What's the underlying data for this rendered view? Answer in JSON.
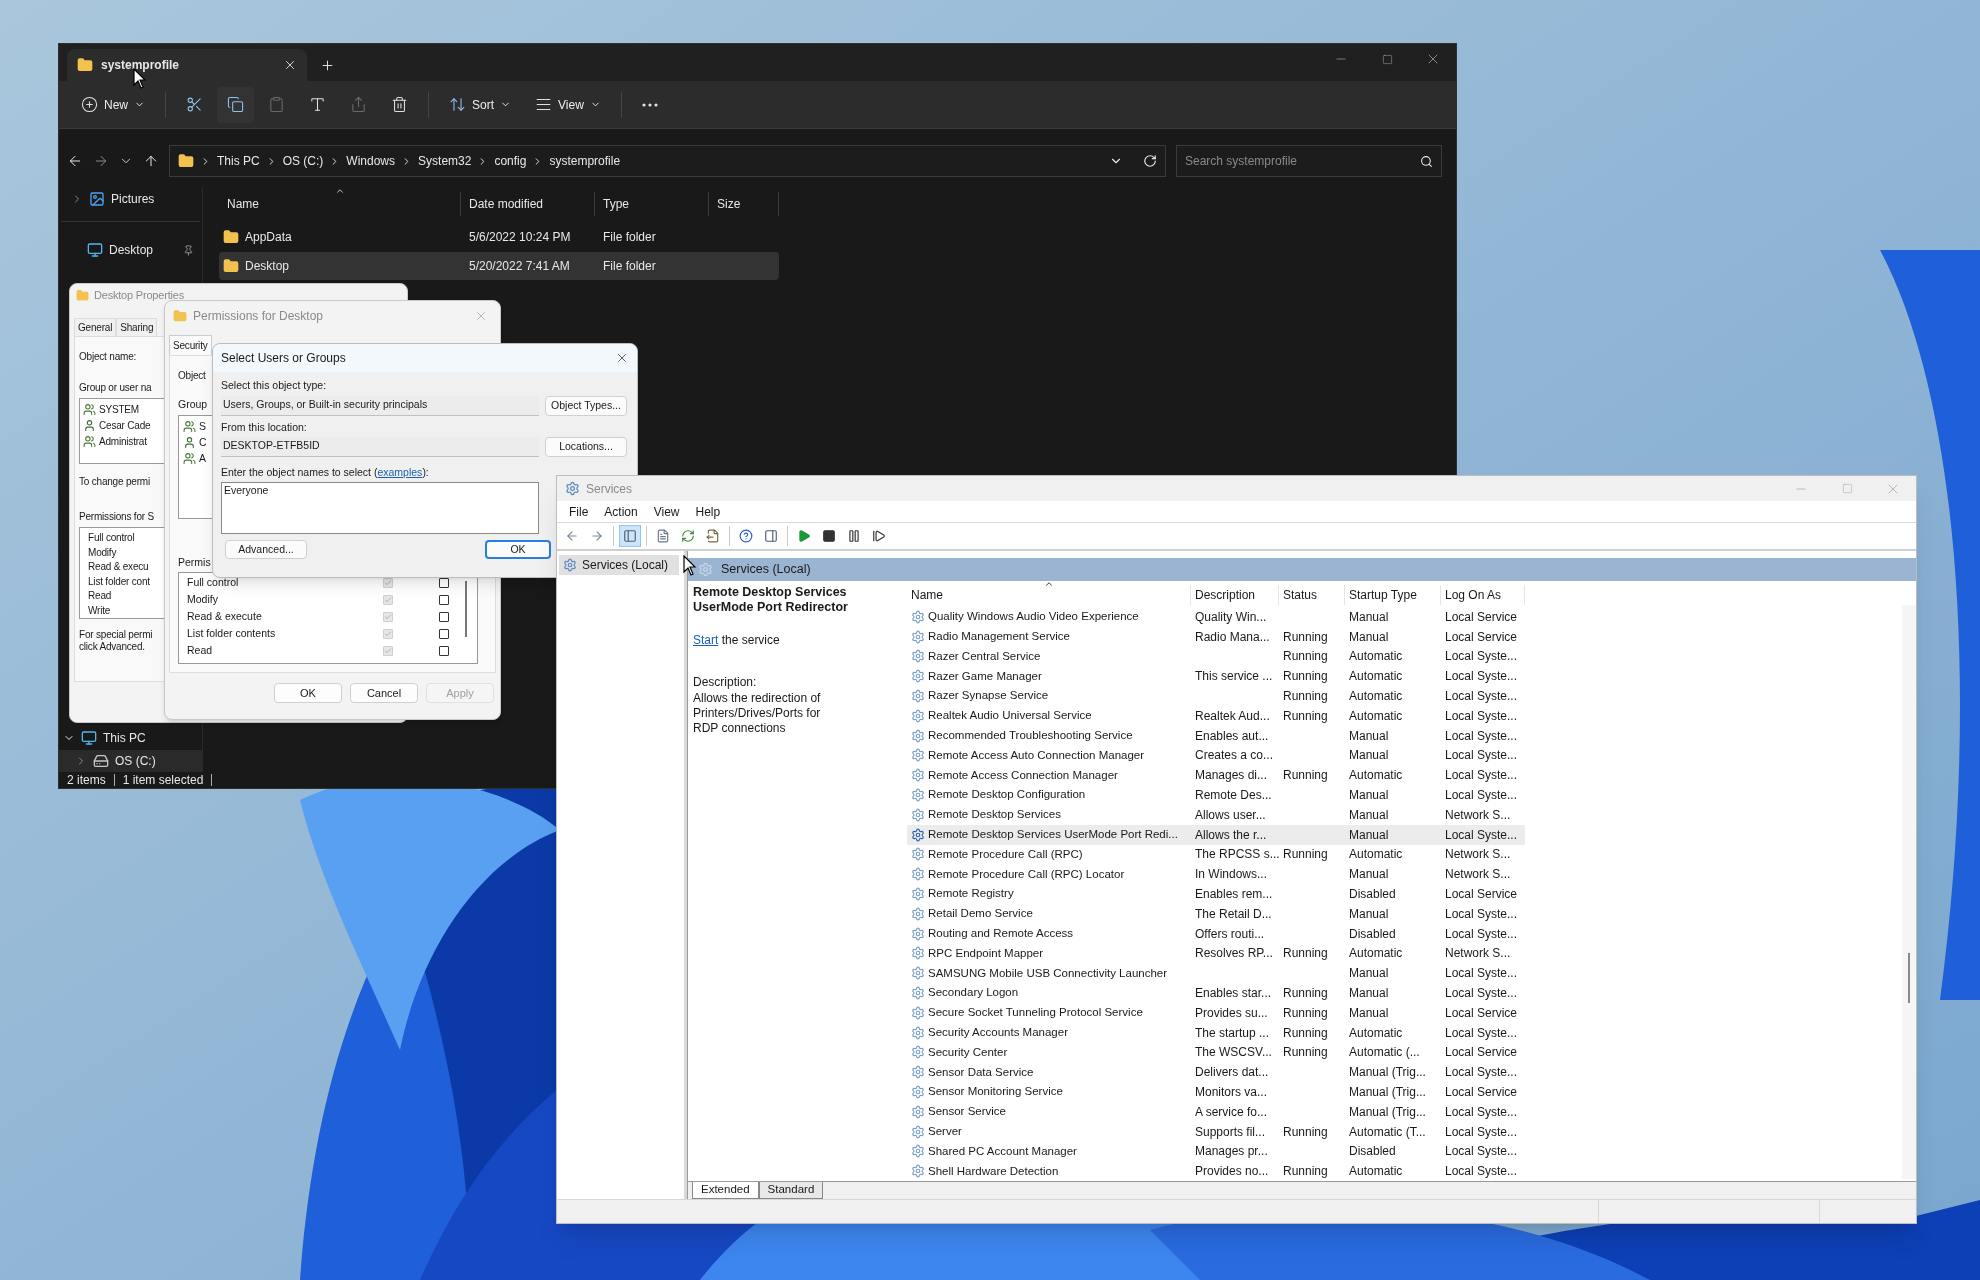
{
  "explorer": {
    "tabs": [
      {
        "label": "systemprofile",
        "selected": true
      }
    ],
    "toolbar": [
      {
        "kind": "new",
        "label": "New",
        "disabled": false
      },
      {
        "kind": "cut",
        "disabled": false
      },
      {
        "kind": "copy",
        "disabled": false
      },
      {
        "kind": "paste",
        "disabled": true
      },
      {
        "kind": "rename",
        "disabled": false
      },
      {
        "kind": "share",
        "disabled": true
      },
      {
        "kind": "delete",
        "disabled": false
      },
      {
        "kind": "sort",
        "label": "Sort",
        "disabled": false
      },
      {
        "kind": "view",
        "label": "View",
        "disabled": false
      },
      {
        "kind": "more",
        "disabled": false
      }
    ],
    "address": [
      "This PC",
      "OS (C:)",
      "Windows",
      "System32",
      "config",
      "systemprofile"
    ],
    "search": {
      "placeholder": "Search systemprofile"
    },
    "sidebar": {
      "quick_access": [
        {
          "label": "Pictures",
          "kind": "pictures",
          "expanded": false
        },
        {
          "label": "Desktop",
          "kind": "desktop",
          "pinned": true
        }
      ],
      "this_pc": [
        {
          "label": "This PC",
          "kind": "pc",
          "expanded": true
        },
        {
          "label": "OS (C:)",
          "kind": "drive",
          "expanded": false
        }
      ]
    },
    "columns": [
      {
        "label": "Name",
        "sorted": true
      },
      {
        "label": "Date modified",
        "sorted": false
      },
      {
        "label": "Type",
        "sorted": false
      },
      {
        "label": "Size",
        "sorted": false
      }
    ],
    "rows": [
      {
        "name": "AppData",
        "date": "5/6/2022 10:24 PM",
        "type": "File folder",
        "selected": false
      },
      {
        "name": "Desktop",
        "date": "5/20/2022 7:41 AM",
        "type": "File folder",
        "selected": true
      }
    ],
    "status": [
      "2 items",
      "1 item selected"
    ]
  },
  "desktop_properties": {
    "title": "Desktop Properties",
    "tabs": [
      {
        "label": "General",
        "selected": false
      },
      {
        "label": "Sharing",
        "selected": false
      }
    ],
    "object_name_label": "Object name:",
    "group_label": "Group or user na",
    "users": [
      {
        "name": "SYSTEM",
        "kind": "group"
      },
      {
        "name": "Cesar Cade",
        "kind": "user"
      },
      {
        "name": "Administrat",
        "kind": "group"
      }
    ],
    "change_note": "To change permi",
    "permissions_label": "Permissions for S",
    "permissions": [
      "Full control",
      "Modify",
      "Read & execu",
      "List folder cont",
      "Read",
      "Write"
    ],
    "special_note": [
      "For special permi",
      "click Advanced."
    ]
  },
  "permissions_dialog": {
    "title": "Permissions for Desktop",
    "tabs": [
      {
        "label": "Security",
        "selected": true
      }
    ],
    "object_label": "Object",
    "group_label": "Group",
    "users": [
      {
        "name": "S",
        "kind": "group"
      },
      {
        "name": "C",
        "kind": "user"
      },
      {
        "name": "A",
        "kind": "group"
      }
    ],
    "permissions_label": "Permis",
    "permissions": [
      {
        "name": "Full control",
        "allow": true,
        "inherited": true,
        "deny": false
      },
      {
        "name": "Modify",
        "allow": true,
        "inherited": true,
        "deny": false
      },
      {
        "name": "Read & execute",
        "allow": true,
        "inherited": true,
        "deny": false
      },
      {
        "name": "List folder contents",
        "allow": true,
        "inherited": true,
        "deny": false
      },
      {
        "name": "Read",
        "allow": true,
        "inherited": true,
        "deny": false
      }
    ],
    "buttons": [
      {
        "label": "OK",
        "disabled": false
      },
      {
        "label": "Cancel",
        "disabled": false
      },
      {
        "label": "Apply",
        "disabled": true
      }
    ]
  },
  "select_dialog": {
    "title": "Select Users or Groups",
    "type_label": "Select this object type:",
    "type_value": "Users, Groups, or Built-in security principals",
    "object_types_button": "Object Types...",
    "location_label": "From this location:",
    "location_value": "DESKTOP-ETFB5ID",
    "locations_button": "Locations...",
    "names_label": {
      "before": "Enter the object names to select (",
      "link": "examples",
      "after": "):"
    },
    "names_value": "Everyone",
    "advanced_button": "Advanced...",
    "ok_button": "OK"
  },
  "services": {
    "title": "Services",
    "menu": [
      "File",
      "Action",
      "View",
      "Help"
    ],
    "toolbar": [
      {
        "kind": "back",
        "selected": false
      },
      {
        "kind": "forward",
        "selected": false
      },
      {
        "kind": "tree",
        "selected": true
      },
      {
        "kind": "properties",
        "selected": false
      },
      {
        "kind": "refresh",
        "selected": false
      },
      {
        "kind": "export",
        "selected": false
      },
      {
        "kind": "help",
        "selected": false
      },
      {
        "kind": "action_pane",
        "selected": false
      },
      {
        "kind": "start",
        "selected": false
      },
      {
        "kind": "stop",
        "selected": false
      },
      {
        "kind": "pause",
        "selected": false
      },
      {
        "kind": "resume",
        "selected": false
      }
    ],
    "tree": [
      {
        "label": "Services (Local)",
        "selected": true
      }
    ],
    "band": "Services (Local)",
    "detail": {
      "title": "Remote Desktop Services UserMode Port Redirector",
      "action_link": "Start",
      "action_text": "the service",
      "description_label": "Description:",
      "description": "Allows the redirection of Printers/Drives/Ports for RDP connections"
    },
    "columns": [
      {
        "label": "Name",
        "sorted": true
      },
      {
        "label": "Description",
        "sorted": false
      },
      {
        "label": "Status",
        "sorted": false
      },
      {
        "label": "Startup Type",
        "sorted": false
      },
      {
        "label": "Log On As",
        "sorted": false
      }
    ],
    "rows": [
      {
        "name": "Quality Windows Audio Video Experience",
        "description": "Quality Win...",
        "startup_type": "Manual",
        "log_on_as": "Local Service",
        "selected": false
      },
      {
        "name": "Radio Management Service",
        "description": "Radio Mana...",
        "status": "Running",
        "startup_type": "Manual",
        "log_on_as": "Local Service",
        "selected": false
      },
      {
        "name": "Razer Central Service",
        "status": "Running",
        "startup_type": "Automatic",
        "log_on_as": "Local Syste...",
        "selected": false
      },
      {
        "name": "Razer Game Manager",
        "description": "This service ...",
        "status": "Running",
        "startup_type": "Automatic",
        "log_on_as": "Local Syste...",
        "selected": false
      },
      {
        "name": "Razer Synapse Service",
        "status": "Running",
        "startup_type": "Automatic",
        "log_on_as": "Local Syste...",
        "selected": false
      },
      {
        "name": "Realtek Audio Universal Service",
        "description": "Realtek Aud...",
        "status": "Running",
        "startup_type": "Automatic",
        "log_on_as": "Local Syste...",
        "selected": false
      },
      {
        "name": "Recommended Troubleshooting Service",
        "description": "Enables aut...",
        "startup_type": "Manual",
        "log_on_as": "Local Syste...",
        "selected": false
      },
      {
        "name": "Remote Access Auto Connection Manager",
        "description": "Creates a co...",
        "startup_type": "Manual",
        "log_on_as": "Local Syste...",
        "selected": false
      },
      {
        "name": "Remote Access Connection Manager",
        "description": "Manages di...",
        "status": "Running",
        "startup_type": "Automatic",
        "log_on_as": "Local Syste...",
        "selected": false
      },
      {
        "name": "Remote Desktop Configuration",
        "description": "Remote Des...",
        "startup_type": "Manual",
        "log_on_as": "Local Syste...",
        "selected": false
      },
      {
        "name": "Remote Desktop Services",
        "description": "Allows user...",
        "startup_type": "Manual",
        "log_on_as": "Network S...",
        "selected": false
      },
      {
        "name": "Remote Desktop Services UserMode Port Redi...",
        "description": "Allows the r...",
        "startup_type": "Manual",
        "log_on_as": "Local Syste...",
        "selected": true
      },
      {
        "name": "Remote Procedure Call (RPC)",
        "description": "The RPCSS s...",
        "status": "Running",
        "startup_type": "Automatic",
        "log_on_as": "Network S...",
        "selected": false
      },
      {
        "name": "Remote Procedure Call (RPC) Locator",
        "description": "In Windows...",
        "startup_type": "Manual",
        "log_on_as": "Network S...",
        "selected": false
      },
      {
        "name": "Remote Registry",
        "description": "Enables rem...",
        "startup_type": "Disabled",
        "log_on_as": "Local Service",
        "selected": false
      },
      {
        "name": "Retail Demo Service",
        "description": "The Retail D...",
        "startup_type": "Manual",
        "log_on_as": "Local Syste...",
        "selected": false
      },
      {
        "name": "Routing and Remote Access",
        "description": "Offers routi...",
        "startup_type": "Disabled",
        "log_on_as": "Local Syste...",
        "selected": false
      },
      {
        "name": "RPC Endpoint Mapper",
        "description": "Resolves RP...",
        "status": "Running",
        "startup_type": "Automatic",
        "log_on_as": "Network S...",
        "selected": false
      },
      {
        "name": "SAMSUNG Mobile USB Connectivity Launcher",
        "startup_type": "Manual",
        "log_on_as": "Local Syste...",
        "selected": false
      },
      {
        "name": "Secondary Logon",
        "description": "Enables star...",
        "status": "Running",
        "startup_type": "Manual",
        "log_on_as": "Local Syste...",
        "selected": false
      },
      {
        "name": "Secure Socket Tunneling Protocol Service",
        "description": "Provides su...",
        "status": "Running",
        "startup_type": "Manual",
        "log_on_as": "Local Service",
        "selected": false
      },
      {
        "name": "Security Accounts Manager",
        "description": "The startup ...",
        "status": "Running",
        "startup_type": "Automatic",
        "log_on_as": "Local Syste...",
        "selected": false
      },
      {
        "name": "Security Center",
        "description": "The WSCSV...",
        "status": "Running",
        "startup_type": "Automatic (...",
        "log_on_as": "Local Service",
        "selected": false
      },
      {
        "name": "Sensor Data Service",
        "description": "Delivers dat...",
        "startup_type": "Manual (Trig...",
        "log_on_as": "Local Syste...",
        "selected": false
      },
      {
        "name": "Sensor Monitoring Service",
        "description": "Monitors va...",
        "startup_type": "Manual (Trig...",
        "log_on_as": "Local Service",
        "selected": false
      },
      {
        "name": "Sensor Service",
        "description": "A service fo...",
        "startup_type": "Manual (Trig...",
        "log_on_as": "Local Syste...",
        "selected": false
      },
      {
        "name": "Server",
        "description": "Supports fil...",
        "status": "Running",
        "startup_type": "Automatic (T...",
        "log_on_as": "Local Syste...",
        "selected": false
      },
      {
        "name": "Shared PC Account Manager",
        "description": "Manages pr...",
        "startup_type": "Disabled",
        "log_on_as": "Local Syste...",
        "selected": false
      },
      {
        "name": "Shell Hardware Detection",
        "description": "Provides no...",
        "status": "Running",
        "startup_type": "Automatic",
        "log_on_as": "Local Syste...",
        "selected": false
      }
    ],
    "tabs": [
      {
        "label": "Extended",
        "selected": true
      },
      {
        "label": "Standard",
        "selected": false
      }
    ]
  }
}
